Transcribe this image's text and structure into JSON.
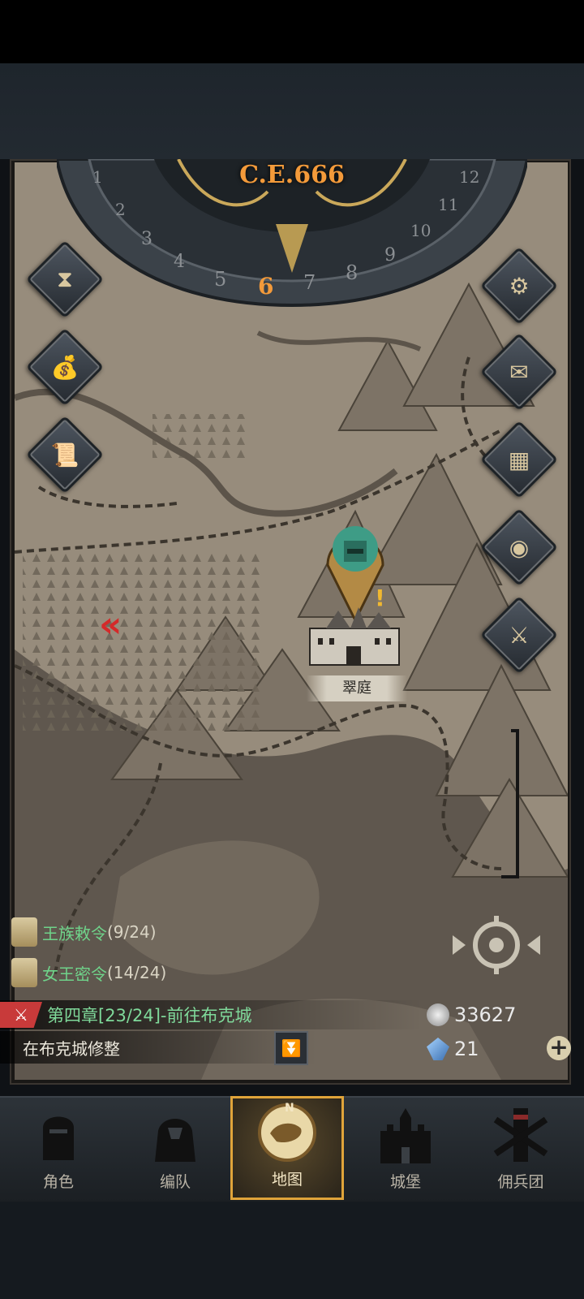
{
  "calendar": {
    "era": "C.E.666",
    "current_month": "6",
    "months": [
      "1",
      "2",
      "3",
      "4",
      "5",
      "6",
      "7",
      "8",
      "9",
      "10",
      "11",
      "12"
    ]
  },
  "left_buttons": [
    {
      "icon": "hourglass-icon"
    },
    {
      "icon": "money-bag-icon"
    },
    {
      "icon": "scroll-icon"
    }
  ],
  "right_buttons": [
    {
      "icon": "gear-icon"
    },
    {
      "icon": "mail-icon"
    },
    {
      "icon": "board-icon"
    },
    {
      "icon": "coin-icon"
    },
    {
      "icon": "knight-icon"
    }
  ],
  "map": {
    "location_name": "翠庭",
    "alert": "!"
  },
  "quests": [
    {
      "name": "王族敕令",
      "progress": "(9/24)"
    },
    {
      "name": "女王密令",
      "progress": "(14/24)"
    }
  ],
  "chapter": {
    "title": "第四章[23/24]-前往布克城",
    "status": "在布克城修整"
  },
  "resources": {
    "silver": "33627",
    "crystal": "21"
  },
  "nav": {
    "compass_letter": "N",
    "tabs": [
      {
        "label": "角色"
      },
      {
        "label": "编队"
      },
      {
        "label": "地图"
      },
      {
        "label": "城堡"
      },
      {
        "label": "佣兵团"
      }
    ]
  },
  "colors": {
    "accent_gold": "#e0a43a",
    "quest_green": "#6fd38a",
    "chapter_red": "#c83a3a",
    "era_orange": "#f39a3a"
  }
}
